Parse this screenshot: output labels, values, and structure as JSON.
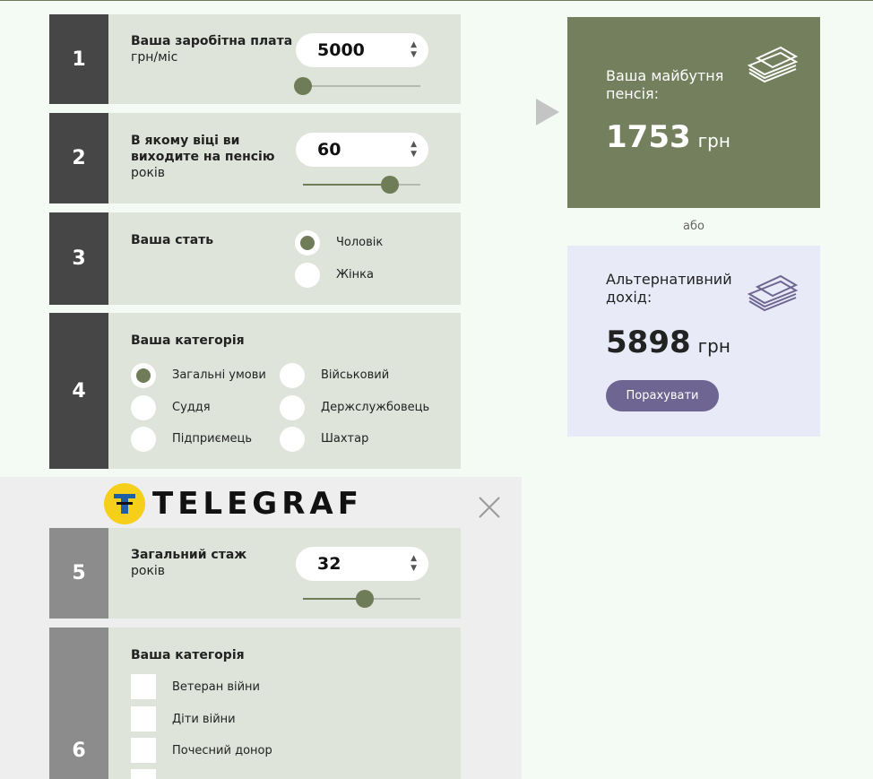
{
  "steps": {
    "s1": {
      "num": "1",
      "title": "Ваша заробітна плата",
      "unit": "грн/міс",
      "value": "5000",
      "slider_fraction": 0.0
    },
    "s2": {
      "num": "2",
      "title": "В якому віці ви виходите на пенсію",
      "unit": "років",
      "value": "60",
      "slider_fraction": 0.74
    },
    "s3": {
      "num": "3",
      "title": "Ваша стать",
      "options": [
        "Чоловік",
        "Жінка"
      ],
      "selected": "Чоловік"
    },
    "s4": {
      "num": "4",
      "title": "Ваша категорія",
      "options": [
        "Загальні умови",
        "Військовий",
        "Суддя",
        "Держслужбовець",
        "Підприємець",
        "Шахтар"
      ],
      "selected": "Загальні умови"
    },
    "s5": {
      "num": "5",
      "title": "Загальний стаж",
      "unit": "років",
      "value": "32",
      "slider_fraction": 0.53
    },
    "s6": {
      "num": "6",
      "title": "Ваша категорія",
      "options": [
        "Ветеран війни",
        "Діти війни",
        "Почесний донор"
      ]
    }
  },
  "ad": {
    "logo_text": "TELEGRAF",
    "close_icon": "close-icon"
  },
  "result": {
    "pension_label": "Ваша майбутня пенсія:",
    "pension_amount": "1753",
    "currency": "грн",
    "or_text": "або",
    "alt_label": "Альтернативний дохід:",
    "alt_amount": "5898",
    "calc_button": "Порахувати"
  },
  "colors": {
    "accent_green": "#74805d",
    "accent_purple": "#6f6592",
    "step_dark": "#464646"
  }
}
